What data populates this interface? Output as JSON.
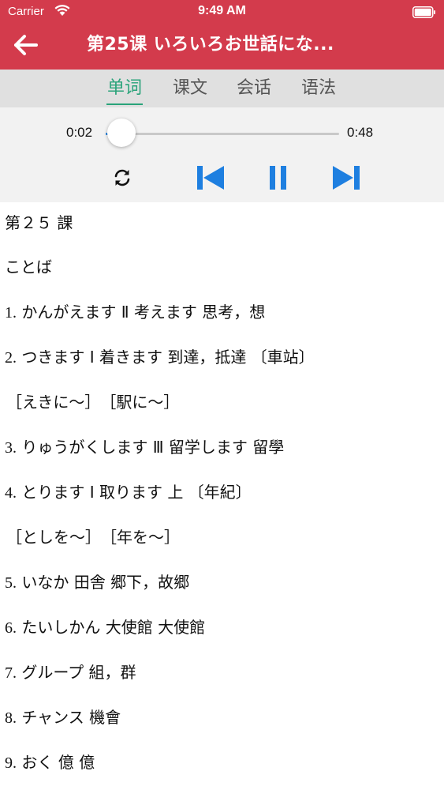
{
  "status_bar": {
    "carrier": "Carrier",
    "time": "9:49 AM"
  },
  "nav": {
    "title": "第25课 いろいろお世話にな..."
  },
  "tabs": [
    {
      "label": "单词",
      "active": true
    },
    {
      "label": "课文",
      "active": false
    },
    {
      "label": "会话",
      "active": false
    },
    {
      "label": "语法",
      "active": false
    }
  ],
  "player": {
    "current_time": "0:02",
    "total_time": "0:48",
    "progress": 0.04,
    "state": "playing"
  },
  "content": {
    "heading": "第２５ 課",
    "subheading": "ことば",
    "lines": [
      {
        "num": "1.",
        "text": " かんがえます Ⅱ 考えます 思考，想"
      },
      {
        "num": "2.",
        "text": " つきます Ⅰ 着きます 到達，抵達 〔車站〕"
      },
      {
        "num": "",
        "text": "［えきに～］　［駅に～］"
      },
      {
        "num": "3.",
        "text": " りゅうがくします Ⅲ 留学します 留學"
      },
      {
        "num": "4.",
        "text": " とります Ⅰ 取ります 上 〔年紀〕"
      },
      {
        "num": "",
        "text": "［としを～］　［年を～］"
      },
      {
        "num": "5.",
        "text": " いなか 田舎 郷下，故郷"
      },
      {
        "num": "6.",
        "text": " たいしかん 大使館 大使館"
      },
      {
        "num": "7.",
        "text": " グループ 組，群"
      },
      {
        "num": "8.",
        "text": " チャンス 機會"
      },
      {
        "num": "9.",
        "text": " おく 億 億"
      }
    ]
  },
  "colors": {
    "header": "#d33b4c",
    "tab_active": "#2aa37a",
    "control_blue": "#1e7fe0"
  },
  "icons": [
    "back-arrow-icon",
    "wifi-icon",
    "battery-icon",
    "repeat-icon",
    "skip-previous-icon",
    "pause-icon",
    "skip-next-icon"
  ]
}
